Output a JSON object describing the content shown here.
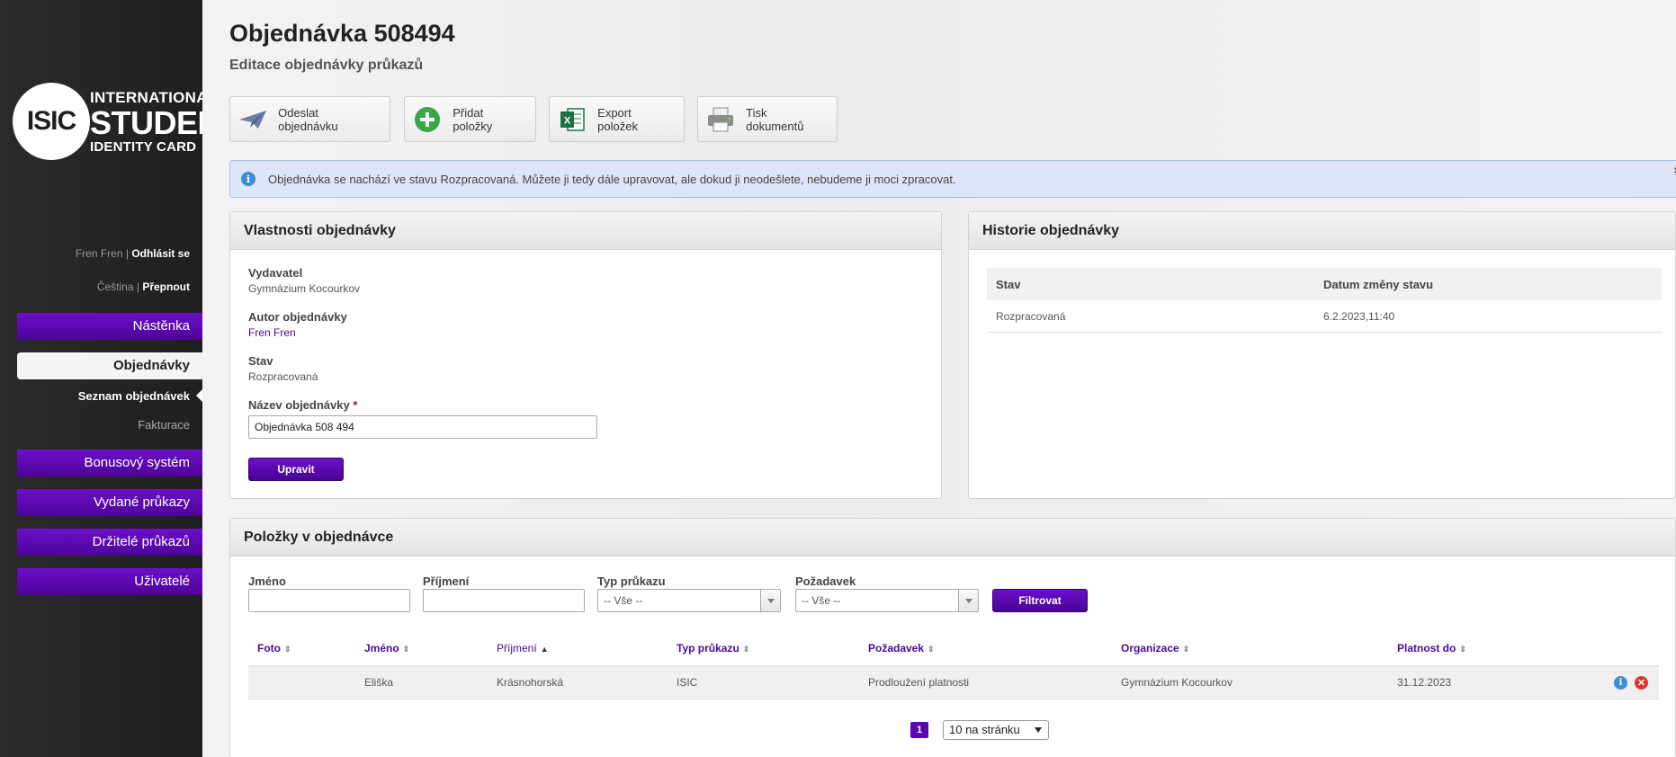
{
  "brand": {
    "logo_short": "ISIC",
    "logo_line1": "INTERNATIONAL",
    "logo_line2": "STUDENT",
    "logo_line3": "IDENTITY CARD"
  },
  "user": {
    "name": "Fren Fren",
    "separator": "|",
    "logout": "Odhlásit se",
    "language": "Čeština",
    "switch": "Přepnout"
  },
  "nav": {
    "items": [
      {
        "label": "Nástěnka"
      },
      {
        "label": "Objednávky"
      },
      {
        "label": "Bonusový systém"
      },
      {
        "label": "Vydané průkazy"
      },
      {
        "label": "Držitelé průkazů"
      },
      {
        "label": "Uživatelé"
      }
    ],
    "subitems": [
      {
        "label": "Seznam objednávek"
      },
      {
        "label": "Fakturace"
      }
    ]
  },
  "page": {
    "title": "Objednávka 508494",
    "subtitle": "Editace objednávky průkazů"
  },
  "toolbar": {
    "send": "Odeslat objednávku",
    "add": "Přidat položky",
    "export": "Export položek",
    "print": "Tisk dokumentů"
  },
  "info": {
    "message": "Objednávka se nachází ve stavu Rozpracovaná. Můžete ji tedy dále upravovat, ale dokud ji neodešlete, nebudeme ji moci zpracovat.",
    "close": "×"
  },
  "props": {
    "title": "Vlastnosti objednávky",
    "issuer_label": "Vydavatel",
    "issuer_value": "Gymnázium Kocourkov",
    "author_label": "Autor objednávky",
    "author_value": "Fren Fren",
    "status_label": "Stav",
    "status_value": "Rozpracovaná",
    "name_label": "Název objednávky",
    "required_mark": "*",
    "name_value": "Objednávka 508 494",
    "save_button": "Upravit"
  },
  "history": {
    "title": "Historie objednávky",
    "columns": [
      "Stav",
      "Datum změny stavu"
    ],
    "rows": [
      [
        "Rozpracovaná",
        "6.2.2023,11:40"
      ]
    ]
  },
  "items": {
    "title": "Položky v objednávce",
    "filters": {
      "first_name_label": "Jméno",
      "last_name_label": "Příjmení",
      "card_type_label": "Typ průkazu",
      "card_type_value": "-- Vše --",
      "request_label": "Požadavek",
      "request_value": "-- Vše --",
      "filter_button": "Filtrovat"
    },
    "columns": [
      "Foto",
      "Jméno",
      "Příjmení",
      "Typ průkazu",
      "Požadavek",
      "Organizace",
      "Platnost do"
    ],
    "sort_icon": "⇕",
    "sort_active_icon": "▲",
    "rows": [
      {
        "foto": "",
        "jmeno": "Eliška",
        "prijmeni": "Krásnohorská",
        "typ": "ISIC",
        "pozadavek": "Prodloužení platnosti",
        "organizace": "Gymnázium Kocourkov",
        "platnost": "31.12.2023"
      }
    ],
    "pager": {
      "current_page": "1",
      "per_page": "10 na stránku"
    }
  },
  "colors": {
    "accent": "#5a06b5",
    "sidebar": "#262626",
    "info_bg": "#dce6f8"
  }
}
